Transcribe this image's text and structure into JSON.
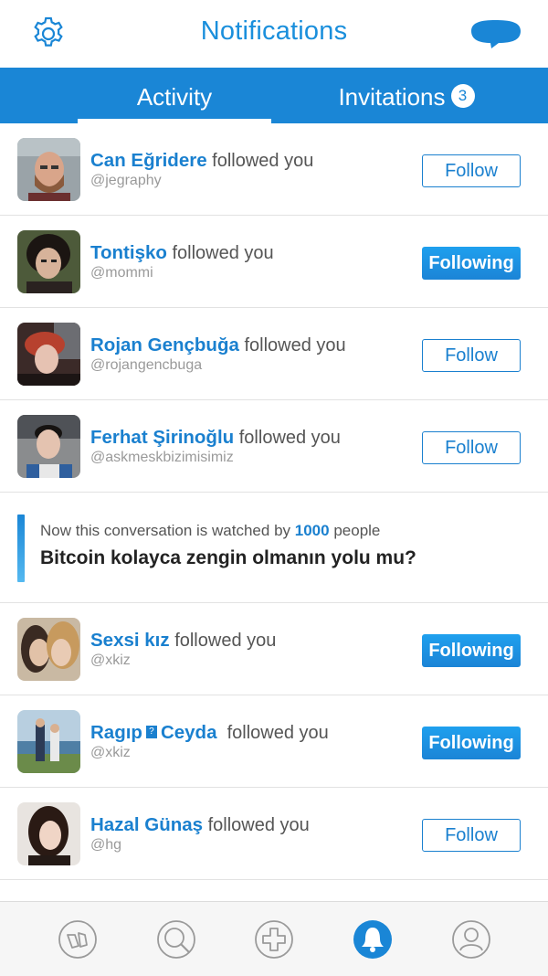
{
  "header": {
    "title": "Notifications",
    "settings_icon": "gear-icon",
    "messages_icon": "chat-bubble-icon",
    "accent": "#1a86d6"
  },
  "tabs": [
    {
      "label": "Activity",
      "active": true
    },
    {
      "label": "Invitations",
      "badge": "3",
      "active": false
    }
  ],
  "notifications": [
    {
      "name": "Can Eğridere",
      "action": "followed you",
      "handle": "@jegraphy",
      "button": "Follow"
    },
    {
      "name": "Tontişko",
      "action": "followed you",
      "handle": "@mommi",
      "button": "Following"
    },
    {
      "name": "Rojan Gençbuğa",
      "action": "followed you",
      "handle": "@rojangencbuga",
      "button": "Follow"
    },
    {
      "name": "Ferhat Şirinoğlu",
      "action": "followed you",
      "handle": "@askmeskbizimisimiz",
      "button": "Follow"
    },
    {
      "name": "Sexsi kız",
      "action": "followed you",
      "handle": "@xkiz",
      "button": "Following"
    },
    {
      "name_a": "Ragıp",
      "name_sep": "?",
      "name_b": "Ceyda",
      "action": "followed you",
      "handle": "@xkiz",
      "button": "Following"
    },
    {
      "name": "Hazal Günaş",
      "action": "followed you",
      "handle": "@hg",
      "button": "Follow"
    }
  ],
  "conversation": {
    "prefix": "Now this conversation is watched by",
    "count": "1000",
    "suffix": "people",
    "title": "Bitcoin kolayca zengin olmanın yolu mu?"
  },
  "bottom_nav": [
    {
      "icon": "feed-icon"
    },
    {
      "icon": "search-icon"
    },
    {
      "icon": "add-icon"
    },
    {
      "icon": "bell-icon",
      "active": true
    },
    {
      "icon": "profile-icon"
    }
  ]
}
